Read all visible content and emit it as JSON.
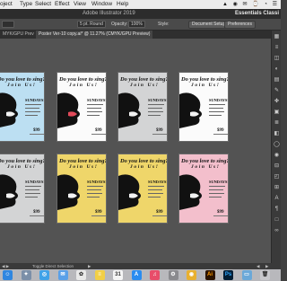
{
  "menubar": {
    "items": [
      "oject",
      "Type",
      "Select",
      "Effect",
      "View",
      "Window",
      "Help"
    ],
    "status_icons": "▲ ◉ ✉ ⌚ ◔ ☰"
  },
  "titlebar": {
    "app_title": "Adobe Illustrator 2019",
    "workspace": "Essentials Classi"
  },
  "controlbar": {
    "stroke_value": "5 pt. Round",
    "opacity_label": "Opacity:",
    "opacity_value": "100%",
    "style_label": "Style:",
    "document_setup": "Document Setup",
    "preferences": "Preferences"
  },
  "tabs": [
    {
      "label": "MYK/GPU Preview)",
      "active": false
    },
    {
      "label": "Poster Ver-10 copy.ai* @ 11.27% (CMYK/GPU Preview)",
      "active": true
    }
  ],
  "posters": [
    {
      "variant": "blue"
    },
    {
      "variant": "white"
    },
    {
      "variant": "grey"
    },
    {
      "variant": "white"
    },
    {
      "variant": "grey"
    },
    {
      "variant": "yellow"
    },
    {
      "variant": "yellow"
    },
    {
      "variant": "pink"
    }
  ],
  "poster_text": {
    "headline": "Do you love to sing?",
    "sub": "Join Us!",
    "question": "SUNDAYS!",
    "price": "$99"
  },
  "statusbar": {
    "tool": "Toggle Direct Selection"
  },
  "dock": {
    "apps": [
      {
        "icon": "finder-icon",
        "glyph": "☺",
        "color": "#2f86e0"
      },
      {
        "icon": "launchpad-icon",
        "glyph": "✦",
        "color": "#7b8fa8"
      },
      {
        "icon": "safari-icon",
        "glyph": "◎",
        "color": "#3fa2e8"
      },
      {
        "icon": "mail-icon",
        "glyph": "✉",
        "color": "#5aa0e8"
      },
      {
        "icon": "photos-icon",
        "glyph": "✿",
        "color": "#e8e8e8"
      },
      {
        "icon": "notes-icon",
        "glyph": "≡",
        "color": "#f2cf46"
      },
      {
        "icon": "calendar-icon",
        "glyph": "31",
        "color": "#f5f5f5"
      },
      {
        "icon": "app-store-icon",
        "glyph": "A",
        "color": "#2a8cf0"
      },
      {
        "icon": "music-icon",
        "glyph": "♫",
        "color": "#e84d6a"
      },
      {
        "icon": "system-preferences-icon",
        "glyph": "⚙",
        "color": "#8a8a8e"
      },
      {
        "icon": "chrome-icon",
        "glyph": "◉",
        "color": "#e8b030"
      },
      {
        "icon": "illustrator-icon",
        "glyph": "Ai",
        "color": "#2b1300"
      },
      {
        "icon": "photoshop-icon",
        "glyph": "Ps",
        "color": "#001d34"
      },
      {
        "icon": "folder-icon",
        "glyph": "▭",
        "color": "#6aa8d8"
      },
      {
        "icon": "trash-icon",
        "glyph": "🗑",
        "color": "#c8c8cc"
      }
    ]
  }
}
